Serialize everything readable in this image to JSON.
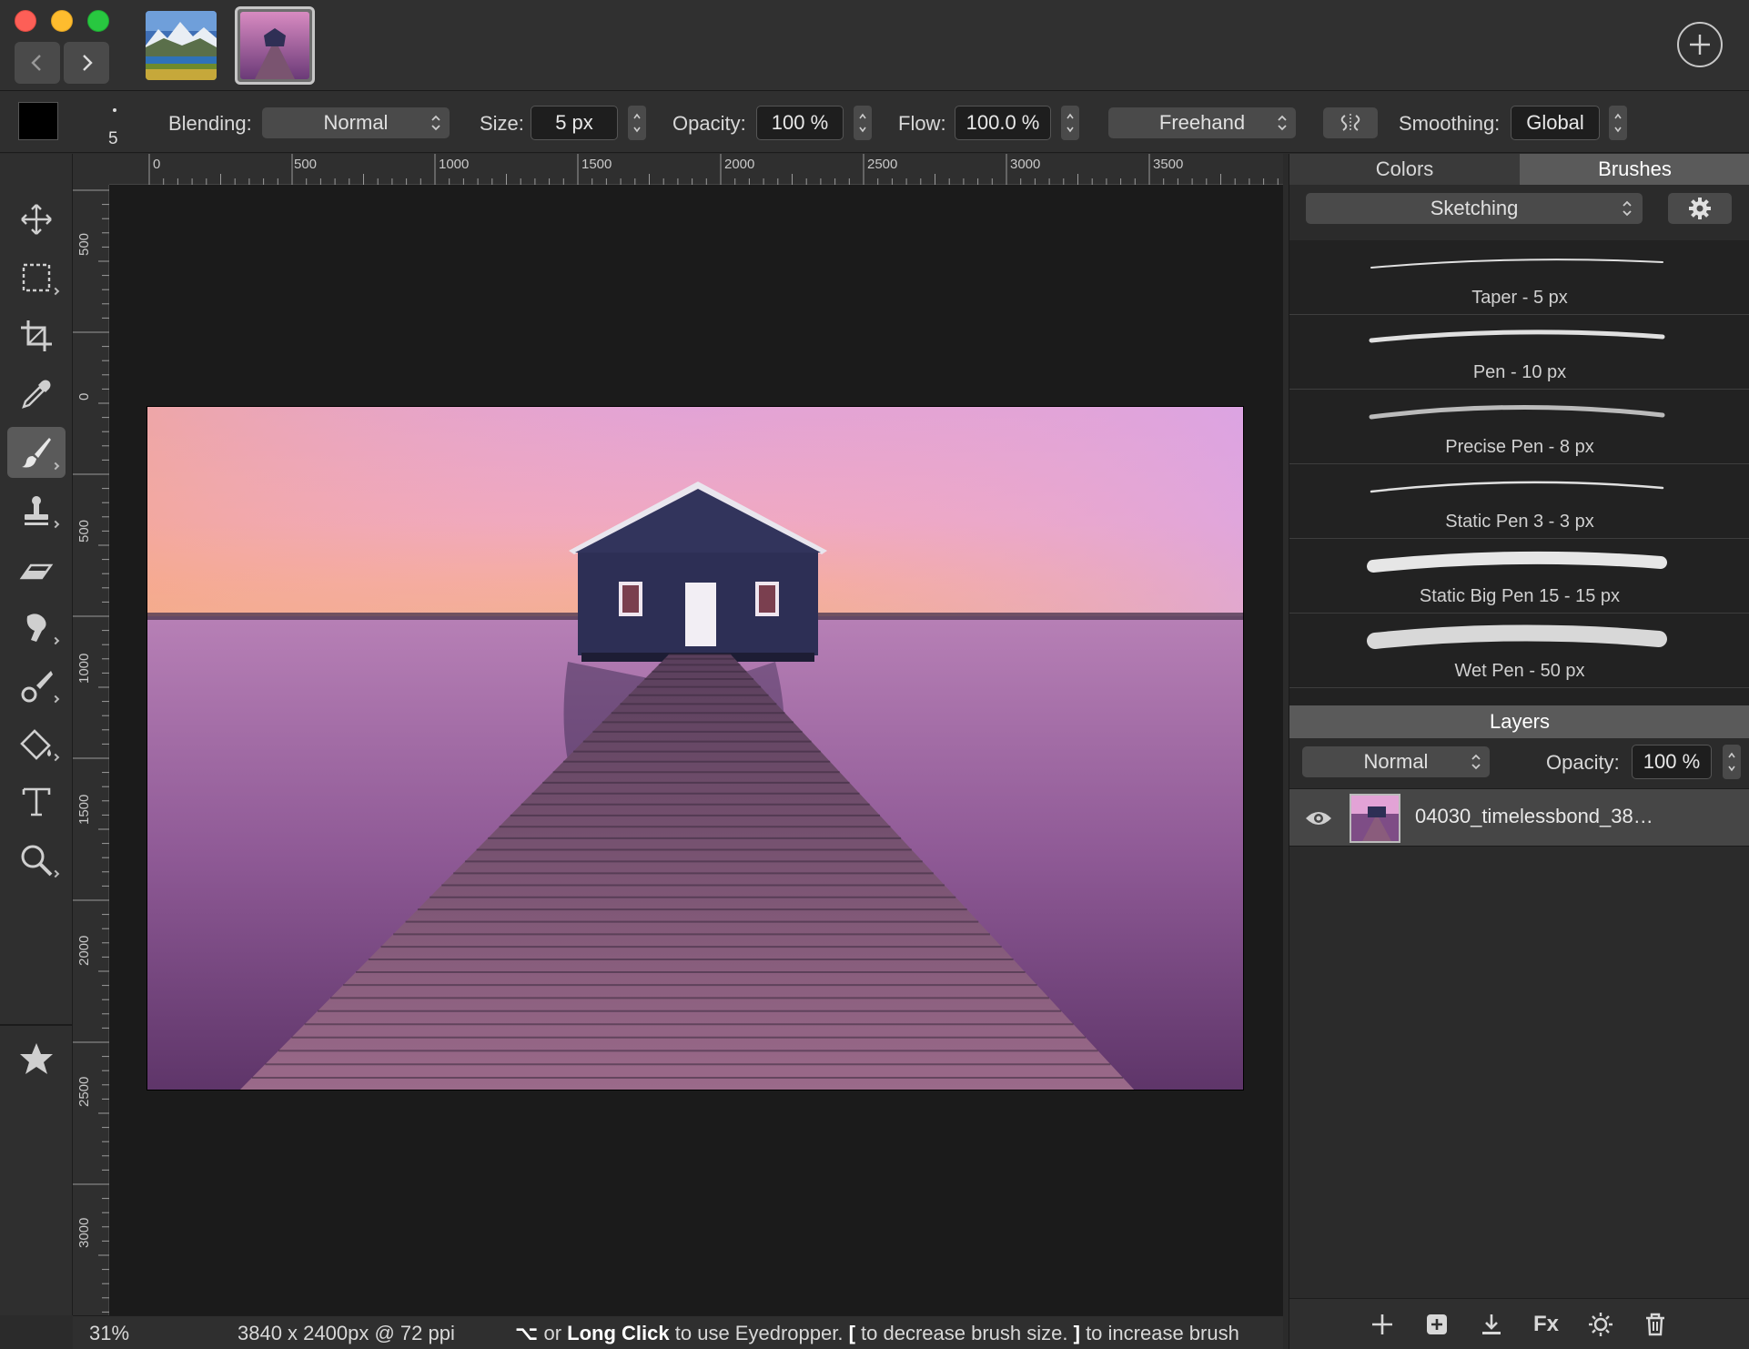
{
  "titlebar": {
    "buttons": {
      "close": "close",
      "minimize": "minimize",
      "zoom": "zoom"
    },
    "nav_back_icon": "chevron-left-icon",
    "nav_forward_icon": "chevron-right-icon",
    "add_tab_icon": "plus-icon"
  },
  "options": {
    "color": "#000000",
    "brush_size_preview": "5",
    "blending_label": "Blending:",
    "blending_value": "Normal",
    "size_label": "Size:",
    "size_value": "5 px",
    "opacity_label": "Opacity:",
    "opacity_value": "100 %",
    "flow_label": "Flow:",
    "flow_value": "100.0 %",
    "mode_value": "Freehand",
    "symmetry_icon": "symmetry-icon",
    "smoothing_label": "Smoothing:",
    "smoothing_value": "Global"
  },
  "tools": [
    "move-tool",
    "selection-tool",
    "crop-tool",
    "eyedropper-tool",
    "brush-tool",
    "stamp-tool",
    "eraser-tool",
    "smudge-tool",
    "retouch-tool",
    "fill-tool",
    "text-tool",
    "zoom-tool",
    "favorites-tool"
  ],
  "ruler": {
    "h_labels": [
      "0",
      "500",
      "1000",
      "1500",
      "2000",
      "2500",
      "3000",
      "3500"
    ],
    "v_labels": [
      "500",
      "0",
      "500",
      "1000",
      "1500",
      "2000",
      "2500",
      "3000"
    ]
  },
  "status": {
    "zoom": "31%",
    "dimensions": "3840 x 2400px @ 72 ppi",
    "hint_key": "⌥",
    "hint_or": "or",
    "hint_bold": "Long Click",
    "hint_text1": "to use Eyedropper.",
    "hint_lb": "[",
    "hint_text2": "to decrease brush size.",
    "hint_rb": "]",
    "hint_text3": "to increase brush"
  },
  "panel": {
    "tabs": [
      {
        "label": "Colors"
      },
      {
        "label": "Brushes"
      }
    ],
    "brush_set": "Sketching",
    "brushes": [
      {
        "label": "Taper - 5 px"
      },
      {
        "label": "Pen - 10 px"
      },
      {
        "label": "Precise Pen - 8 px"
      },
      {
        "label": "Static Pen 3 - 3 px"
      },
      {
        "label": "Static Big Pen 15 - 15 px"
      },
      {
        "label": "Wet Pen - 50 px"
      }
    ],
    "layers_title": "Layers",
    "layers_blend": "Normal",
    "layers_opacity_label": "Opacity:",
    "layers_opacity_value": "100 %",
    "layer_name": "04030_timelessbond_38…"
  },
  "layer_footer_icons": [
    "add-layer-icon",
    "add-group-icon",
    "merge-down-icon",
    "fx-icon",
    "adjustments-icon",
    "trash-icon"
  ],
  "layer_footer": {
    "fx": "Fx"
  }
}
